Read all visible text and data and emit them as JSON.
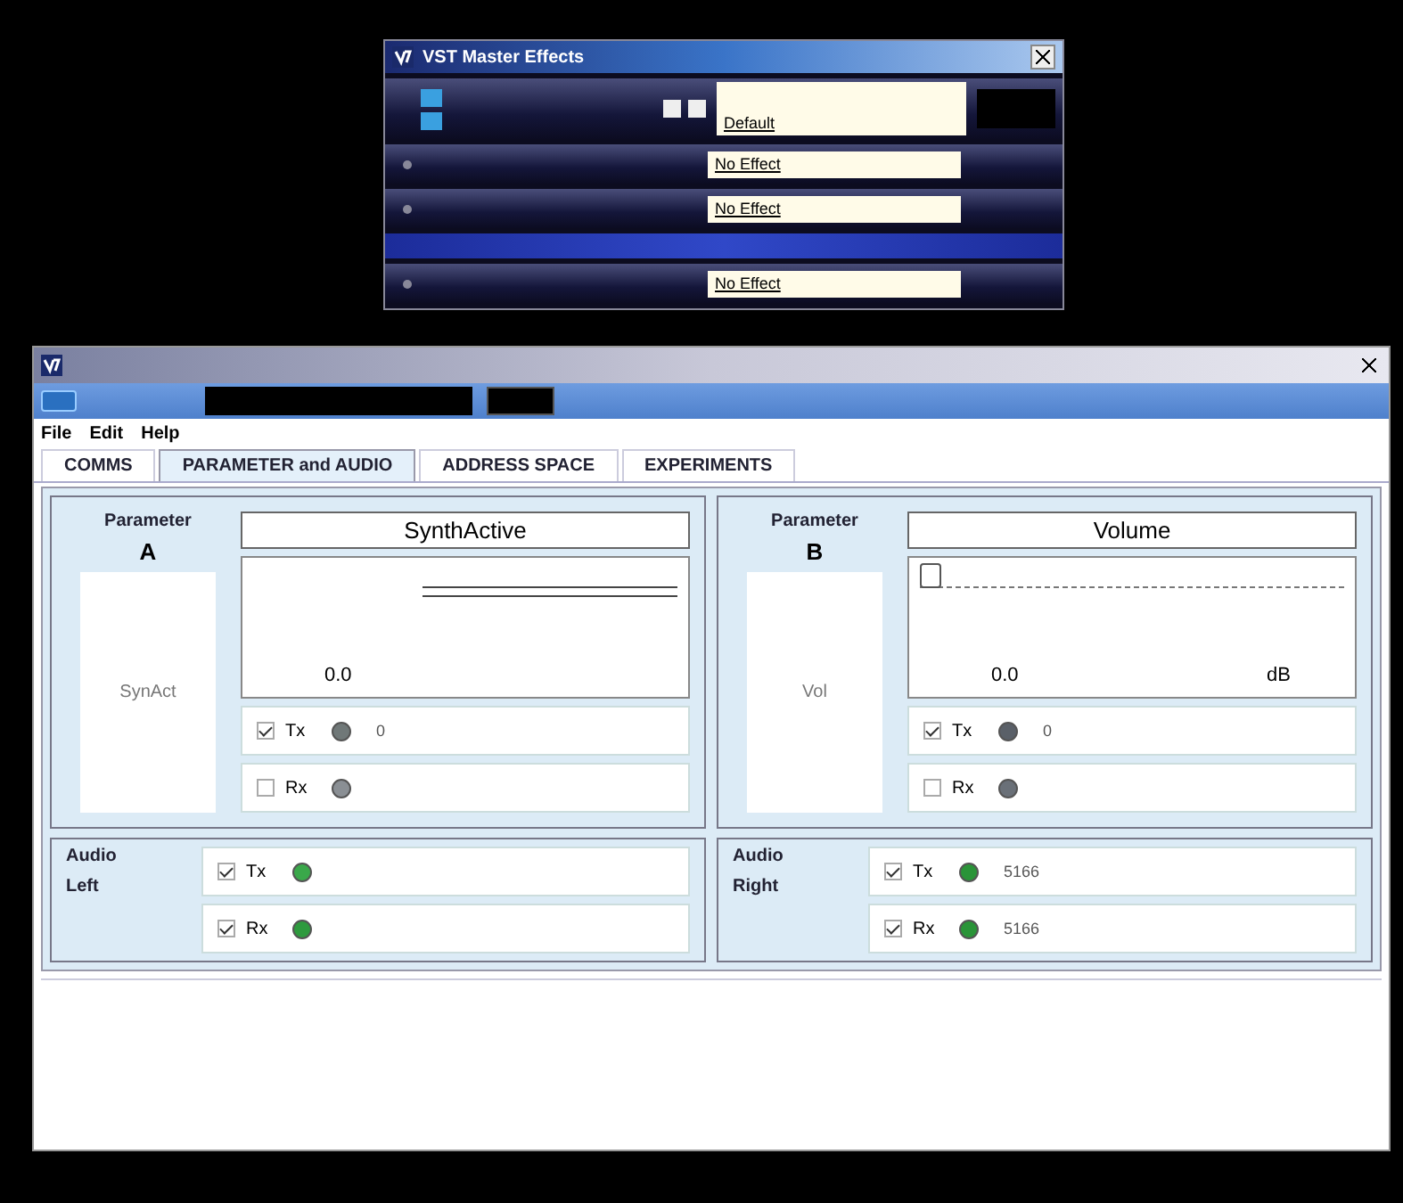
{
  "top_window": {
    "title": "VST Master Effects",
    "slots": [
      {
        "kind": "preset",
        "value": "Default"
      },
      {
        "kind": "effect",
        "value": "No Effect"
      },
      {
        "kind": "effect",
        "value": "No Effect"
      },
      {
        "kind": "master"
      },
      {
        "kind": "effect",
        "value": "No Effect"
      }
    ]
  },
  "main_window": {
    "menu": [
      "File",
      "Edit",
      "Help"
    ],
    "tabs": [
      {
        "label": "COMMS",
        "selected": false
      },
      {
        "label": "PARAMETER and AUDIO",
        "selected": true
      },
      {
        "label": "ADDRESS SPACE",
        "selected": false
      },
      {
        "label": "EXPERIMENTS",
        "selected": false
      }
    ],
    "parameters": [
      {
        "label": "Parameter",
        "letter": "A",
        "name": "SynthActive",
        "short": "SynAct",
        "kind": "switch",
        "value": "0.0",
        "links": [
          {
            "label": "Tx",
            "checked": true,
            "color": "#707878",
            "value": "0"
          },
          {
            "label": "Rx",
            "checked": false,
            "color": "#8a8f94"
          }
        ]
      },
      {
        "label": "Parameter",
        "letter": "B",
        "name": "Volume",
        "short": "Vol",
        "kind": "slider",
        "level": 0.0,
        "value": "0.0",
        "unit": "dB",
        "links": [
          {
            "label": "Tx",
            "checked": true,
            "color": "#5a6068",
            "value": "0"
          },
          {
            "label": "Rx",
            "checked": false,
            "color": "#6a7078"
          }
        ]
      }
    ],
    "audio": [
      {
        "label": "Audio",
        "side": "Left",
        "links": [
          {
            "label": "Tx",
            "checked": true,
            "color": "#3aa84a"
          },
          {
            "label": "Rx",
            "checked": true,
            "color": "#2e9a3e"
          }
        ]
      },
      {
        "label": "Audio",
        "side": "Right",
        "links": [
          {
            "label": "Tx",
            "checked": true,
            "color": "#2a9438",
            "value": "5166"
          },
          {
            "label": "Rx",
            "checked": true,
            "color": "#2a9438",
            "value": "5166"
          }
        ]
      }
    ]
  }
}
